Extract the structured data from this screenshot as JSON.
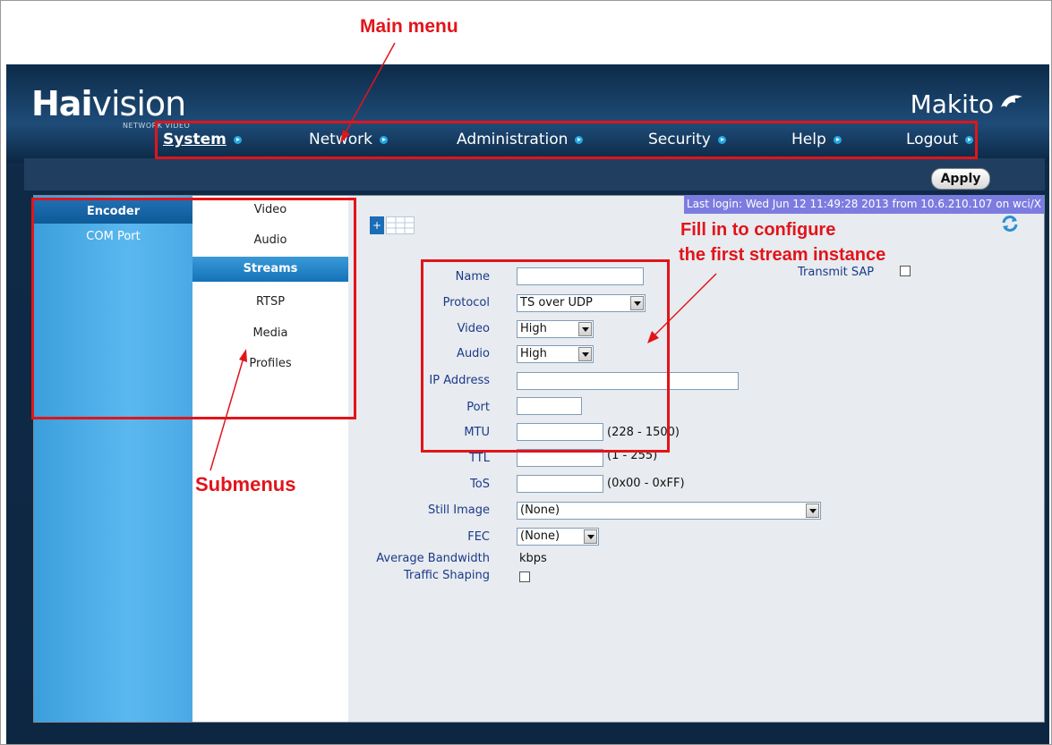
{
  "annotations": {
    "main_menu": "Main menu",
    "submenus": "Submenus",
    "fill_in_line1": "Fill in to configure",
    "fill_in_line2": "the first stream instance"
  },
  "header": {
    "logo_bold": "Hai",
    "logo_rest": "vision",
    "logo_tagline": "NETWORK VIDEO",
    "product": "Makito"
  },
  "nav": {
    "items": [
      {
        "label": "System",
        "active": true
      },
      {
        "label": "Network",
        "active": false
      },
      {
        "label": "Administration",
        "active": false
      },
      {
        "label": "Security",
        "active": false
      },
      {
        "label": "Help",
        "active": false
      },
      {
        "label": "Logout",
        "active": false
      }
    ]
  },
  "toolbar": {
    "apply_label": "Apply"
  },
  "status": {
    "last_login": "Last login: Wed Jun 12 11:49:28 2013 from 10.6.210.107 on wci/X"
  },
  "left_menu": {
    "items": [
      {
        "label": "Encoder",
        "active": true
      },
      {
        "label": "COM Port",
        "active": false
      }
    ]
  },
  "sub_menu": {
    "items": [
      {
        "label": "Video",
        "active": false
      },
      {
        "label": "Audio",
        "active": false
      },
      {
        "label": "Streams",
        "active": true
      },
      {
        "label": "RTSP",
        "active": false
      },
      {
        "label": "Media",
        "active": false
      },
      {
        "label": "Profiles",
        "active": false
      }
    ]
  },
  "stream_form": {
    "add_label": "+",
    "name": {
      "label": "Name",
      "value": ""
    },
    "protocol": {
      "label": "Protocol",
      "value": "TS over UDP"
    },
    "video": {
      "label": "Video",
      "value": "High"
    },
    "audio": {
      "label": "Audio",
      "value": "High"
    },
    "ip_address": {
      "label": "IP Address",
      "value": ""
    },
    "port": {
      "label": "Port",
      "value": ""
    },
    "mtu": {
      "label": "MTU",
      "value": "",
      "hint": "(228 - 1500)"
    },
    "ttl": {
      "label": "TTL",
      "value": "",
      "hint": "(1 - 255)"
    },
    "tos": {
      "label": "ToS",
      "value": "",
      "hint": "(0x00 - 0xFF)"
    },
    "still_image": {
      "label": "Still Image",
      "value": "(None)"
    },
    "fec": {
      "label": "FEC",
      "value": "(None)"
    },
    "avg_bandwidth": {
      "label": "Average Bandwidth",
      "value": "kbps"
    },
    "traffic_shaping": {
      "label": "Traffic Shaping",
      "checked": false
    },
    "transmit_sap": {
      "label": "Transmit SAP",
      "checked": false
    }
  },
  "colors": {
    "annotation_red": "#e1141a",
    "nav_bg": "#0f2a47",
    "sidebar_blue": "#4aa9e4",
    "active_blue": "#1473b8",
    "login_bar": "#7c7ce0"
  }
}
